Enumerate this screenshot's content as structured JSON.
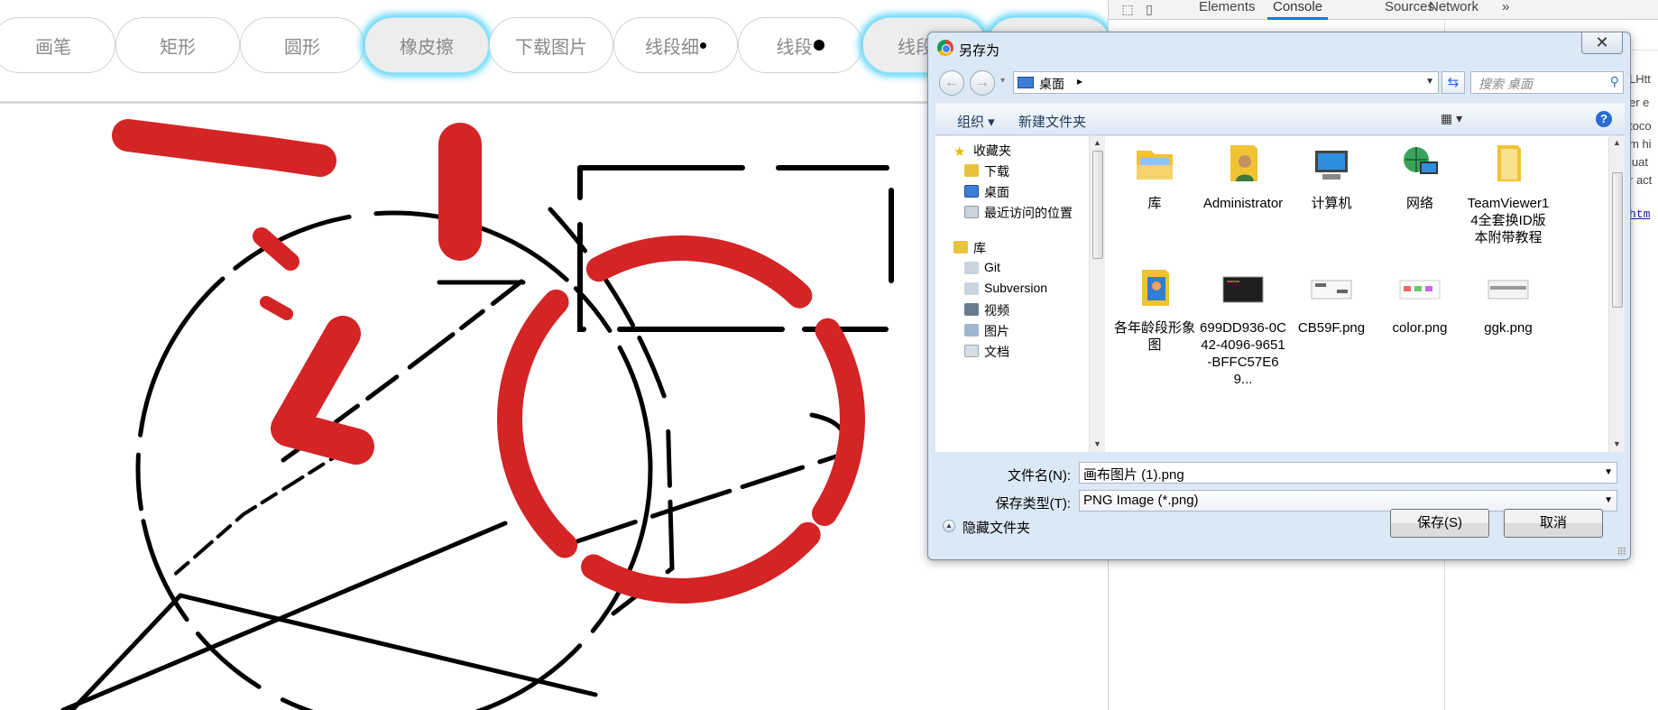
{
  "toolbar": {
    "buttons": [
      {
        "label": "画笔"
      },
      {
        "label": "矩形"
      },
      {
        "label": "圆形"
      },
      {
        "label": "橡皮擦"
      },
      {
        "label": "下载图片"
      },
      {
        "label": "线段细"
      },
      {
        "label": "线段"
      },
      {
        "label": "线段粗"
      },
      {
        "label": ""
      }
    ],
    "active_index": 3
  },
  "canvas": {
    "stroke_colors": {
      "red": "#d42426",
      "black": "#000000"
    }
  },
  "devtools": {
    "tabs": [
      "Elements",
      "Console",
      "Sources",
      "Network"
    ],
    "selected_tab": "Console",
    "more": "»",
    "right_fragments": [
      "LHtt",
      "er e",
      "toco",
      "m hi",
      "luat",
      "r act",
      "htm"
    ]
  },
  "dialog": {
    "title": "另存为",
    "close": "✕",
    "address": {
      "location": "桌面",
      "chevron": "▸"
    },
    "search_placeholder": "搜索 桌面",
    "command_bar": {
      "organize": "组织 ▾",
      "new_folder": "新建文件夹",
      "help": "?"
    },
    "nav_tree": [
      {
        "label": "收藏夹",
        "icon": "star-icon"
      },
      {
        "label": "下载",
        "icon": "download-folder-icon"
      },
      {
        "label": "桌面",
        "icon": "desktop-icon"
      },
      {
        "label": "最近访问的位置",
        "icon": "recent-places-icon"
      },
      {
        "label": "库",
        "icon": "library-icon"
      },
      {
        "label": "Git",
        "icon": "git-icon"
      },
      {
        "label": "Subversion",
        "icon": "subversion-icon"
      },
      {
        "label": "视频",
        "icon": "video-icon"
      },
      {
        "label": "图片",
        "icon": "pictures-icon"
      },
      {
        "label": "文档",
        "icon": "documents-icon"
      }
    ],
    "files": [
      {
        "label": "库",
        "icon": "library-folder-icon"
      },
      {
        "label": "Administrator",
        "icon": "user-folder-icon"
      },
      {
        "label": "计算机",
        "icon": "computer-icon"
      },
      {
        "label": "网络",
        "icon": "network-icon"
      },
      {
        "label": "TeamViewer14全套换ID版本附带教程",
        "icon": "folder-icon"
      },
      {
        "label": "各年龄段形象图",
        "icon": "image-folder-icon"
      },
      {
        "label": "699DD936-0C42-4096-9651-BFFC57E69...",
        "icon": "image-thumbnail-icon"
      },
      {
        "label": "CB59F.png",
        "icon": "image-thumbnail-icon"
      },
      {
        "label": "color.png",
        "icon": "image-thumbnail-icon"
      },
      {
        "label": "ggk.png",
        "icon": "image-thumbnail-icon"
      }
    ],
    "filename_label": "文件名(N):",
    "filename_value": "画布图片 (1).png",
    "filetype_label": "保存类型(T):",
    "filetype_value": "PNG Image (*.png)",
    "hide_folders": "隐藏文件夹",
    "save_button": "保存(S)",
    "cancel_button": "取消"
  }
}
